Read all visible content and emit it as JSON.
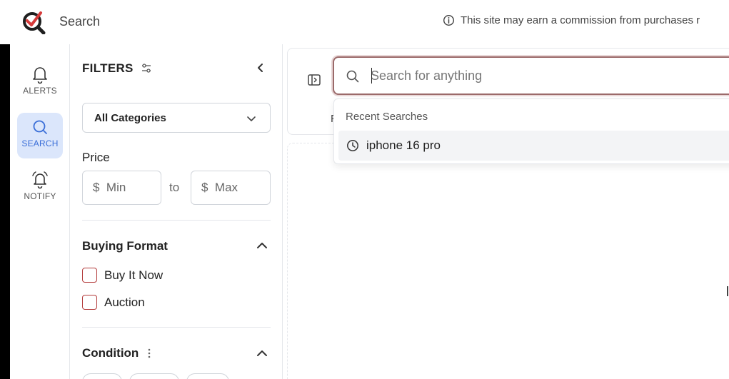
{
  "header": {
    "title": "Search",
    "notice": "This site may earn a commission from purchases r"
  },
  "rail": {
    "items": [
      {
        "label": "ALERTS",
        "icon": "bell-icon"
      },
      {
        "label": "SEARCH",
        "icon": "search-icon",
        "active": true
      },
      {
        "label": "NOTIFY",
        "icon": "bell-ring-icon"
      }
    ]
  },
  "filters": {
    "title": "FILTERS",
    "category": {
      "selected": "All Categories"
    },
    "price": {
      "label": "Price",
      "min_prefix": "$",
      "min_placeholder": "Min",
      "separator": "to",
      "max_prefix": "$",
      "max_placeholder": "Max"
    },
    "buying_format": {
      "title": "Buying Format",
      "options": [
        {
          "label": "Buy It Now",
          "checked": false
        },
        {
          "label": "Auction",
          "checked": false
        }
      ]
    },
    "condition": {
      "title": "Condition"
    }
  },
  "main": {
    "search": {
      "placeholder": "Search for anything",
      "value": ""
    },
    "partial_tab_letter": "P"
  },
  "dropdown": {
    "heading": "Recent Searches",
    "items": [
      {
        "label": "iphone 16 pro",
        "icon": "clock-icon"
      }
    ]
  },
  "colors": {
    "accent_blue": "#3b6fd8",
    "active_bg": "#dbe6fb",
    "search_border": "#9b6a6a",
    "checkbox_border": "#b33b3b",
    "logo_red": "#d63a3a"
  }
}
